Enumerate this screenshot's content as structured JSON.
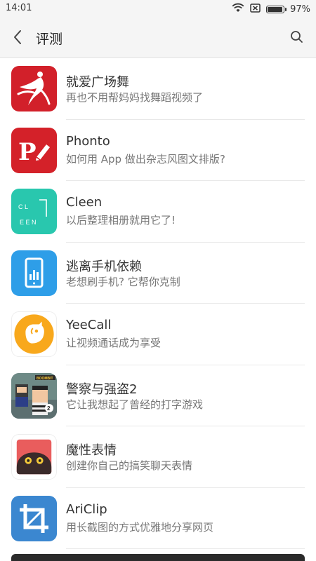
{
  "status_bar": {
    "time": "14:01",
    "battery": "97%",
    "battery_level": 0.97
  },
  "header": {
    "title": "评测"
  },
  "apps": [
    {
      "name": "就爱广场舞",
      "desc": "再也不用帮妈妈找舞蹈视频了",
      "icon": "dancer-icon"
    },
    {
      "name": "Phonto",
      "desc": "如何用 App 做出杂志风图文排版?",
      "icon": "phonto-p-icon"
    },
    {
      "name": "Cleen",
      "desc": "以后整理相册就用它了!",
      "icon": "cleen-icon"
    },
    {
      "name": "逃离手机依赖",
      "desc": "老想刷手机? 它帮你克制",
      "icon": "phone-stats-icon"
    },
    {
      "name": "YeeCall",
      "desc": "让视频通话成为享受",
      "icon": "yeecall-bird-icon"
    },
    {
      "name": "警察与强盗2",
      "desc": "它让我想起了曾经的打字游戏",
      "icon": "cops-robbers-icon",
      "badge": "BOOMBIT"
    },
    {
      "name": "魔性表情",
      "desc": "创建你自己的搞笑聊天表情",
      "icon": "funny-face-icon"
    },
    {
      "name": "AriClip",
      "desc": "用长截图的方式优雅地分享网页",
      "icon": "crop-icon"
    }
  ],
  "icon_letters": {
    "cleen_top": "C  L",
    "cleen_bottom": "E E N"
  }
}
